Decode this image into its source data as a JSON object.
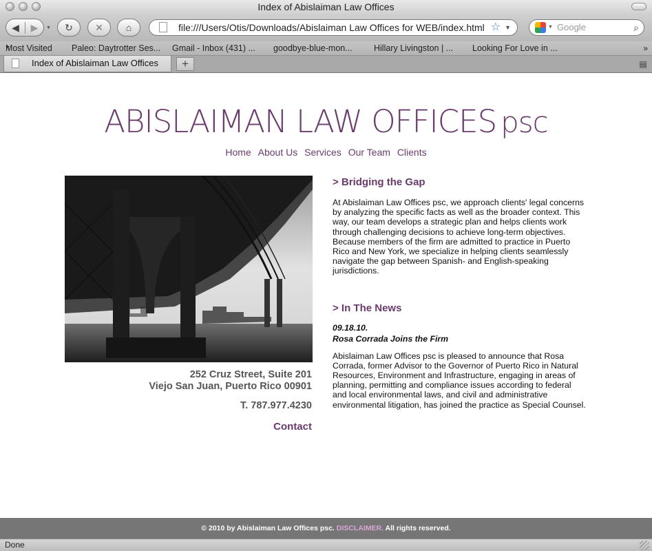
{
  "window": {
    "title": "Index of Abislaiman Law Offices"
  },
  "toolbar": {
    "back_icon": "back-arrow-icon",
    "forward_icon": "forward-arrow-icon",
    "url": "file:///Users/Otis/Downloads/Abislaiman Law Offices for WEB/index.html",
    "search_placeholder": "Google"
  },
  "bookmarks": [
    "Most Visited",
    "Paleo: Daytrotter Ses...",
    "Gmail - Inbox (431) ...",
    "goodbye-blue-mon...",
    "Hillary Livingston | ...",
    "Looking For Love in ..."
  ],
  "tab": {
    "label": "Index of Abislaiman Law Offices"
  },
  "site": {
    "title": "ABISLAIMAN LAW OFFICES",
    "title_suffix": "psc",
    "nav": [
      "Home",
      "About Us",
      "Services",
      "Our Team",
      "Clients"
    ],
    "address_line1": "252 Cruz Street, Suite 201",
    "address_line2": "Viejo San Juan, Puerto Rico 00901",
    "phone": "T. 787.977.4230",
    "contact": "Contact",
    "about_heading": "> Bridging the Gap",
    "about_text": "At Abislaiman Law Offices psc, we approach clients' legal concerns by analyzing the specific facts as well as the broader context. This way, our team develops a strategic plan and helps clients work through challenging decisions to achieve long-term objectives. Because members of the firm are admitted to practice in Puerto Rico and New York, we specialize in helping clients seamlessly navigate the gap between Spanish- and English-speaking jurisdictions.",
    "news_heading": "> In The News",
    "news_date": "09.18.10.",
    "news_title": "Rosa Corrada Joins the Firm",
    "news_text": "Abislaiman Law Offices psc is pleased to announce that Rosa Corrada, former Advisor to the Governor of Puerto Rico in Natural Resources, Environment and Infrastructure, engaging in areas of planning, permitting and compliance issues according to federal and local environmental laws, and civil and administrative environmental litigation, has joined the practice as Special Counsel."
  },
  "footer": {
    "prefix": "© 2010 by Abislaiman Law Offices psc.",
    "disclaimer": "DISCLAIMER.",
    "suffix": "All rights reserved."
  },
  "status": {
    "text": "Done"
  },
  "colors": {
    "brand_purple": "#6b3a6d",
    "footer_bg": "#767676",
    "disclaimer": "#d7a6d7"
  }
}
